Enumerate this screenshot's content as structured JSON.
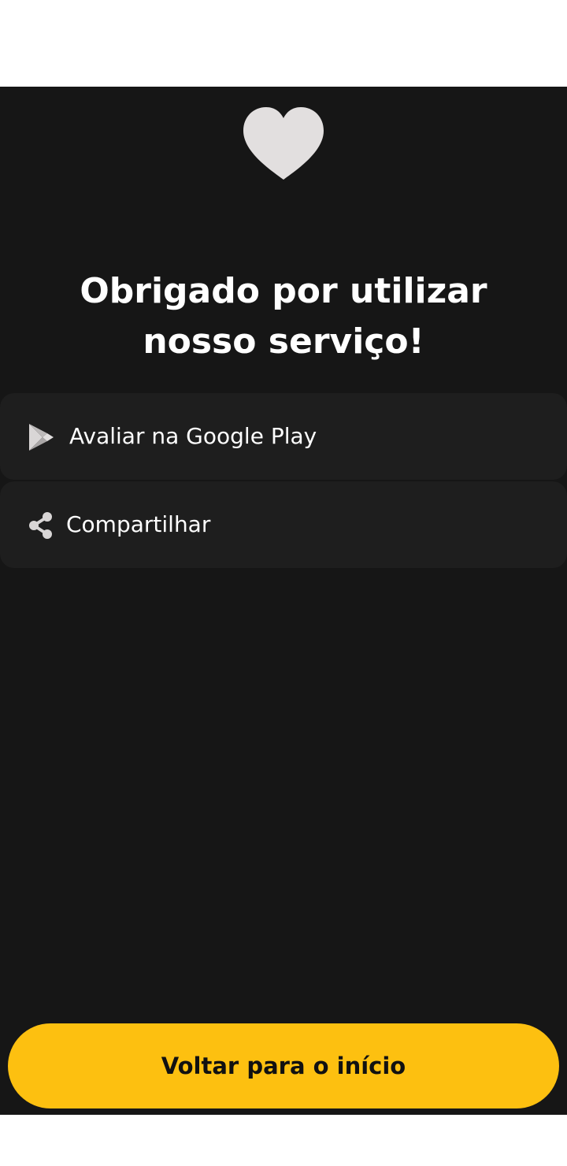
{
  "header": {
    "icon": "heart-icon",
    "title": "Obrigado por utilizar nosso serviço!"
  },
  "actions": [
    {
      "icon": "google-play-icon",
      "label": "Avaliar na Google Play"
    },
    {
      "icon": "share-icon",
      "label": "Compartilhar"
    }
  ],
  "cta": {
    "label": "Voltar para o início"
  },
  "colors": {
    "background": "#161616",
    "card": "#1e1e1e",
    "accent": "#fdc010",
    "icon": "#e2dfdf",
    "text": "#ffffff"
  }
}
